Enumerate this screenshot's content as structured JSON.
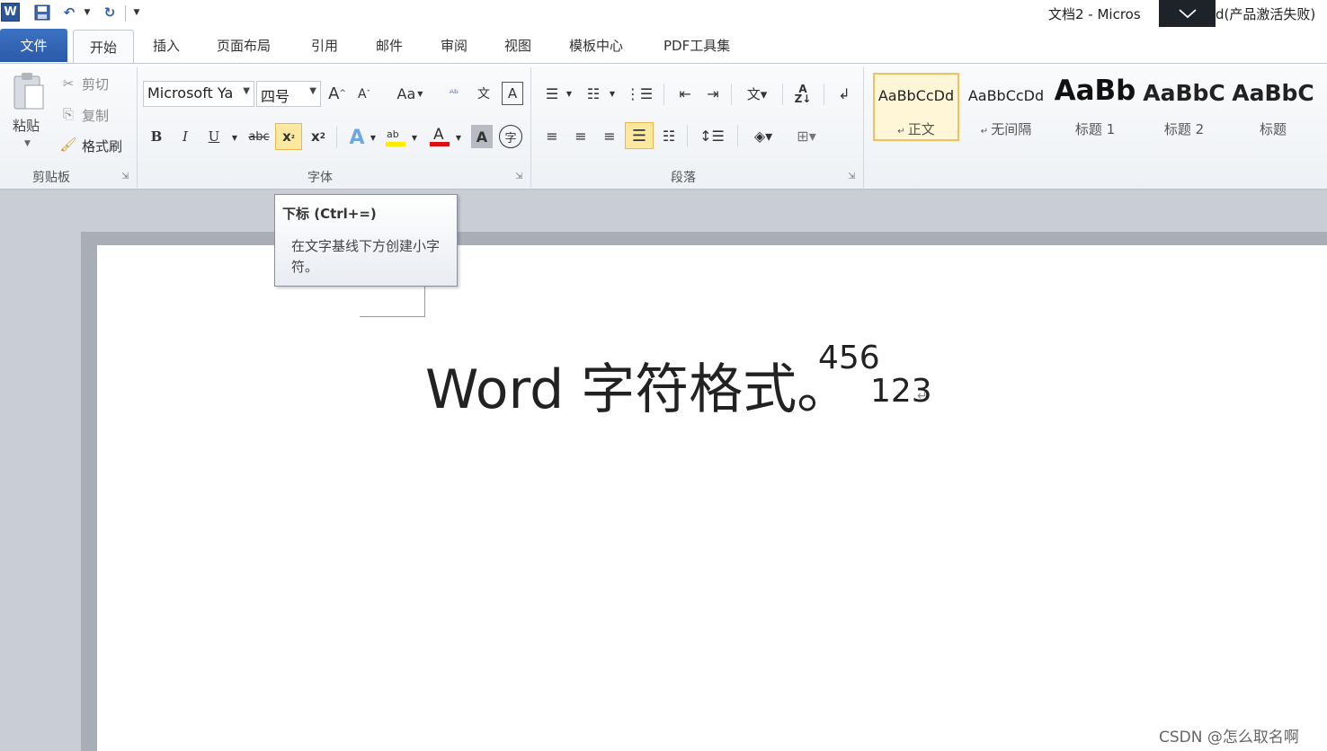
{
  "window": {
    "title": "文档2 - Micros",
    "title_suffix": "d(产品激活失败)",
    "overlay_icon": "chevron-down-icon"
  },
  "quick_access": {
    "logo_letter": "W",
    "items": [
      "save-icon",
      "undo-icon",
      "undo-dropdown-icon",
      "redo-icon",
      "customize-qat-icon"
    ]
  },
  "tabs": {
    "file": "文件",
    "home": "开始",
    "insert": "插入",
    "page_layout": "页面布局",
    "references": "引用",
    "mailings": "邮件",
    "review": "审阅",
    "view": "视图",
    "template_center": "模板中心",
    "pdf_tools": "PDF工具集"
  },
  "clipboard": {
    "paste": "粘贴",
    "cut": "剪切",
    "copy": "复制",
    "format_painter": "格式刷",
    "group_label": "剪贴板"
  },
  "font": {
    "font_name": "Microsoft Ya",
    "font_size": "四号",
    "grow": "A",
    "shrink": "A",
    "change_case": "Aa",
    "bold": "B",
    "italic": "I",
    "underline": "U",
    "strikethrough": "abc",
    "subscript": "x",
    "superscript": "x",
    "group_label": "字体"
  },
  "paragraph": {
    "group_label": "段落"
  },
  "styles": {
    "items": [
      {
        "sample": "AaBbCcDd",
        "name": "正文"
      },
      {
        "sample": "AaBbCcDd",
        "name": "无间隔"
      },
      {
        "sample": "AaBb",
        "name": "标题 1"
      },
      {
        "sample": "AaBbC",
        "name": "标题 2"
      },
      {
        "sample": "AaBbC",
        "name": "标题"
      }
    ]
  },
  "tooltip": {
    "title": "下标 (Ctrl+=)",
    "body": "在文字基线下方创建小字符。"
  },
  "document": {
    "text": "Word 字符格式。",
    "superscript": "456",
    "subscript": "123",
    "para_mark": "↵"
  },
  "watermark": "CSDN @怎么取名啊",
  "colors": {
    "file_tab": "#2b5aa8",
    "ribbon_bg": "#eef1f5",
    "highlight": "#fde8a0",
    "doc_bg": "#c9ced6"
  }
}
